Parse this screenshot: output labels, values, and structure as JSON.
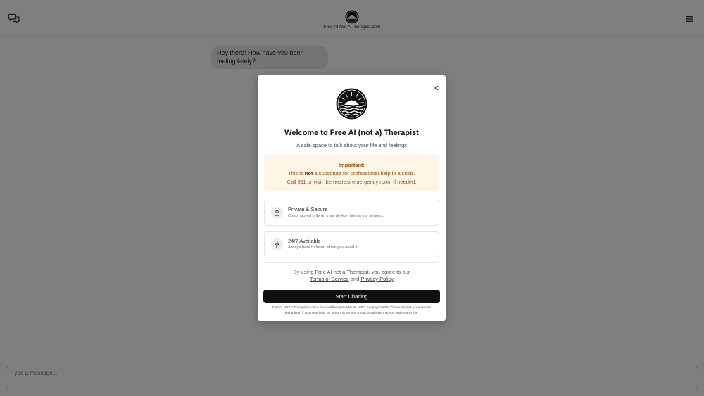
{
  "header": {
    "site_title": "Free AI Not A Therapist.com",
    "left_icon": "chat-bubbles-icon",
    "right_icon": "hamburger-menu-icon"
  },
  "chat": {
    "messages": [
      {
        "role": "assistant",
        "text": "Hey there! How have you been feeling lately?"
      }
    ]
  },
  "composer": {
    "placeholder": "Type a message..."
  },
  "modal": {
    "title": "Welcome to Free AI (not a) Therapist",
    "subtitle": "A safe space to talk about your life and feelings",
    "notice": {
      "heading": "Important:",
      "line1_prefix": "This is ",
      "line1_emphasis": "not",
      "line1_suffix": " a substitute for professional help in a crisis.",
      "line2": "Call 911 or visit the nearest emergency room if needed."
    },
    "features": [
      {
        "icon": "lock-icon",
        "title": "Private & Secure",
        "desc": "Chats stored only on your device, not on our servers."
      },
      {
        "icon": "lightning-icon",
        "title": "24/7 Available",
        "desc": "Always here to listen when you need it"
      }
    ],
    "agree": {
      "prefix": "By using Free AI not a Therapist, you agree to our",
      "terms": "Terms of Service",
      "and": " and ",
      "privacy": "Privacy Policy"
    },
    "start_button": "Start Chatting",
    "disclaimer": "Free AI NOT A Therapist is not a licensed therapist, LMHC, LMFT nor psychiatrist. Please consult a real human therapist(s) if you need help. By using this service you acknowledge that you understand this."
  },
  "colors": {
    "overlay": "#000000",
    "notice_bg": "#fdf6e6",
    "notice_text": "#9b4d0f",
    "button_bg": "#111111"
  }
}
